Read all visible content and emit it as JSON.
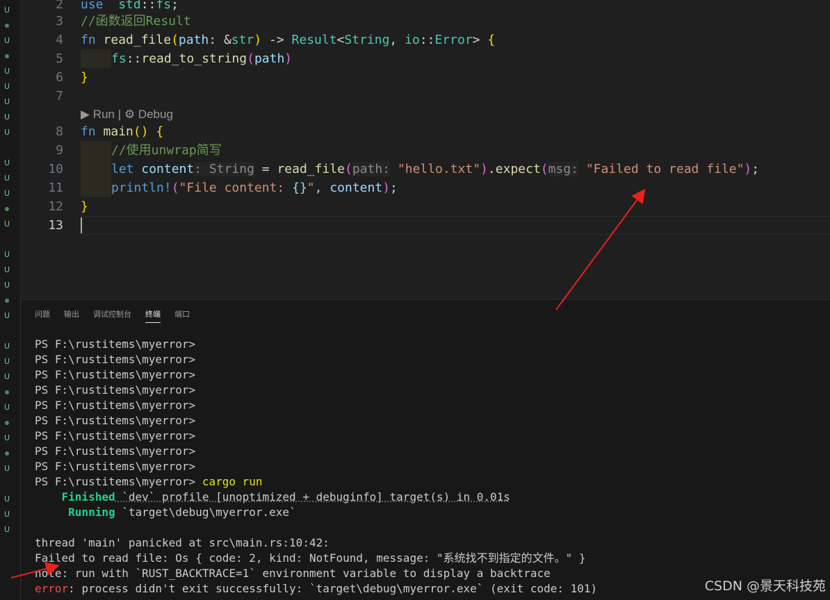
{
  "editor": {
    "lines": [
      {
        "num": "2",
        "tokens": [
          [
            "kw",
            "use"
          ],
          [
            "",
            "  "
          ],
          [
            "ty",
            "std"
          ],
          [
            "",
            "::"
          ],
          [
            "ty",
            "fs"
          ],
          [
            "",
            ";"
          ]
        ]
      },
      {
        "num": "3",
        "tokens": [
          [
            "cm",
            "//函数返回Result"
          ]
        ]
      },
      {
        "num": "4",
        "tokens": [
          [
            "kw",
            "fn"
          ],
          [
            "",
            " "
          ],
          [
            "fn",
            "read_file"
          ],
          [
            "p1",
            "("
          ],
          [
            "var",
            "path"
          ],
          [
            "",
            ": &"
          ],
          [
            "ty",
            "str"
          ],
          [
            "p1",
            ")"
          ],
          [
            "",
            " -> "
          ],
          [
            "ty",
            "Result"
          ],
          [
            "",
            "<"
          ],
          [
            "ty",
            "String"
          ],
          [
            "",
            ", "
          ],
          [
            "ty",
            "io"
          ],
          [
            "",
            "::"
          ],
          [
            "ty",
            "Error"
          ],
          [
            "",
            "> "
          ],
          [
            "p1",
            "{"
          ]
        ]
      },
      {
        "num": "5",
        "indent": 1,
        "tokens": [
          [
            "ty",
            "fs"
          ],
          [
            "",
            "::"
          ],
          [
            "fn",
            "read_to_string"
          ],
          [
            "p2",
            "("
          ],
          [
            "var",
            "path"
          ],
          [
            "p2",
            ")"
          ]
        ]
      },
      {
        "num": "6",
        "tokens": [
          [
            "p1",
            "}"
          ]
        ]
      },
      {
        "num": "7",
        "tokens": []
      },
      {
        "num": "8",
        "tokens": [
          [
            "kw",
            "fn"
          ],
          [
            "",
            " "
          ],
          [
            "fn",
            "main"
          ],
          [
            "p1",
            "()"
          ],
          [
            "",
            " "
          ],
          [
            "p1",
            "{"
          ]
        ]
      },
      {
        "num": "9",
        "indent": 1,
        "tokens": [
          [
            "cm",
            "//使用unwrap简写"
          ]
        ]
      },
      {
        "num": "10",
        "indent": 1,
        "tokens": [
          [
            "kw",
            "let"
          ],
          [
            "",
            " "
          ],
          [
            "var",
            "content"
          ],
          [
            "hint",
            ": String"
          ],
          [
            "",
            " = "
          ],
          [
            "fn",
            "read_file"
          ],
          [
            "p2",
            "("
          ],
          [
            "hint",
            "path:"
          ],
          [
            "",
            " "
          ],
          [
            "str",
            "\"hello.txt\""
          ],
          [
            "p2",
            ")"
          ],
          [
            "",
            "."
          ],
          [
            "fn",
            "expect"
          ],
          [
            "p2",
            "("
          ],
          [
            "hint",
            "msg:"
          ],
          [
            "",
            " "
          ],
          [
            "str",
            "\"Failed to read file\""
          ],
          [
            "p2",
            ")"
          ],
          [
            "",
            ";"
          ]
        ]
      },
      {
        "num": "11",
        "indent": 1,
        "tokens": [
          [
            "mac",
            "println!"
          ],
          [
            "p2",
            "("
          ],
          [
            "str",
            "\"File content: "
          ],
          [
            "ph",
            "{}"
          ],
          [
            "str",
            "\""
          ],
          [
            "",
            ", "
          ],
          [
            "var",
            "content"
          ],
          [
            "p2",
            ")"
          ],
          [
            "",
            ";"
          ]
        ]
      },
      {
        "num": "12",
        "tokens": [
          [
            "p1",
            "}"
          ]
        ]
      },
      {
        "num": "13",
        "tokens": []
      }
    ],
    "codelens": "▶ Run | ⚙ Debug"
  },
  "panel": {
    "tabs": [
      "问题",
      "输出",
      "调试控制台",
      "终端",
      "端口"
    ],
    "active_tab": "终端"
  },
  "terminal": {
    "prompt": "PS F:\\rustitems\\myerror>",
    "prompt_repeats": 9,
    "command": "cargo run",
    "finished_label": "Finished",
    "finished_rest": " `dev` profile [unoptimized + debuginfo] target(s) in 0.01s",
    "running_label": "Running",
    "running_rest": " `target\\debug\\myerror.exe`",
    "panic_line": "thread 'main' panicked at src\\main.rs:10:42:",
    "failed_line": "Failed to read file: Os { code: 2, kind: NotFound, message: \"系统找不到指定的文件。\" }",
    "note_line": "note: run with `RUST_BACKTRACE=1` environment variable to display a backtrace",
    "error_label": "error",
    "error_rest": ": process didn't exit successfully: `target\\debug\\myerror.exe` (exit code: 101)"
  },
  "watermark": "CSDN @景天科技苑",
  "gutter_markers": [
    "u",
    "dot",
    "u",
    "dot",
    "u",
    "u",
    "u",
    "u",
    "u",
    "",
    "u",
    "u",
    "u",
    "dot",
    "u",
    "",
    "u",
    "u",
    "u",
    "dot",
    "u",
    "",
    "u",
    "u",
    "u",
    "dot",
    "u",
    "dot",
    "u",
    "dot",
    "u",
    "",
    "u",
    "u",
    "u"
  ],
  "colors": {
    "editor_bg": "#1f1f1f",
    "panel_bg": "#181818",
    "annotation_arrow": "#e8231c"
  }
}
